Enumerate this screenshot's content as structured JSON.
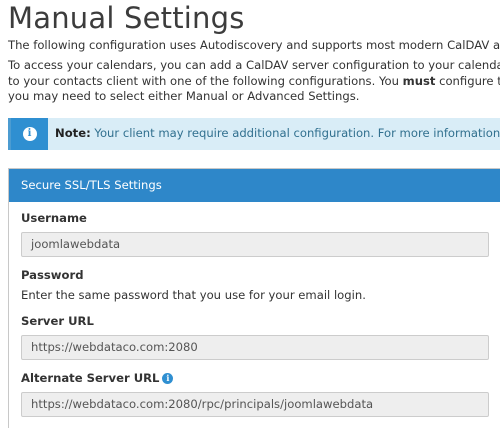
{
  "page": {
    "title": "Manual Settings",
    "intro": "The following configuration uses Autodiscovery and supports most modern CalDAV and CardDAV",
    "para": {
      "line1": "To access your calendars, you can add a CalDAV server configuration to your calendar client wit",
      "line2_pre": "to your contacts client with one of the following configurations. You ",
      "line2_bold": "must",
      "line2_post": " configure the server s",
      "line3": "you may need to select either Manual or Advanced Settings."
    }
  },
  "alert": {
    "icon": "info-icon",
    "label": "Note:",
    "text": " Your client may require additional configuration. For more information, read the"
  },
  "panel": {
    "heading": "Secure SSL/TLS Settings",
    "username_label": "Username",
    "username_value": "joomlawebdata",
    "password_label": "Password",
    "password_help": "Enter the same password that you use for your email login.",
    "server_url_label": "Server URL",
    "server_url_value": "https://webdataco.com:2080",
    "alt_server_url_label": "Alternate Server URL",
    "alt_server_url_value": "https://webdataco.com:2080/rpc/principals/joomlawebdata"
  },
  "colors": {
    "accent": "#2e87c9",
    "alert_bg": "#d9edf7",
    "field_bg": "#eeeeee"
  }
}
